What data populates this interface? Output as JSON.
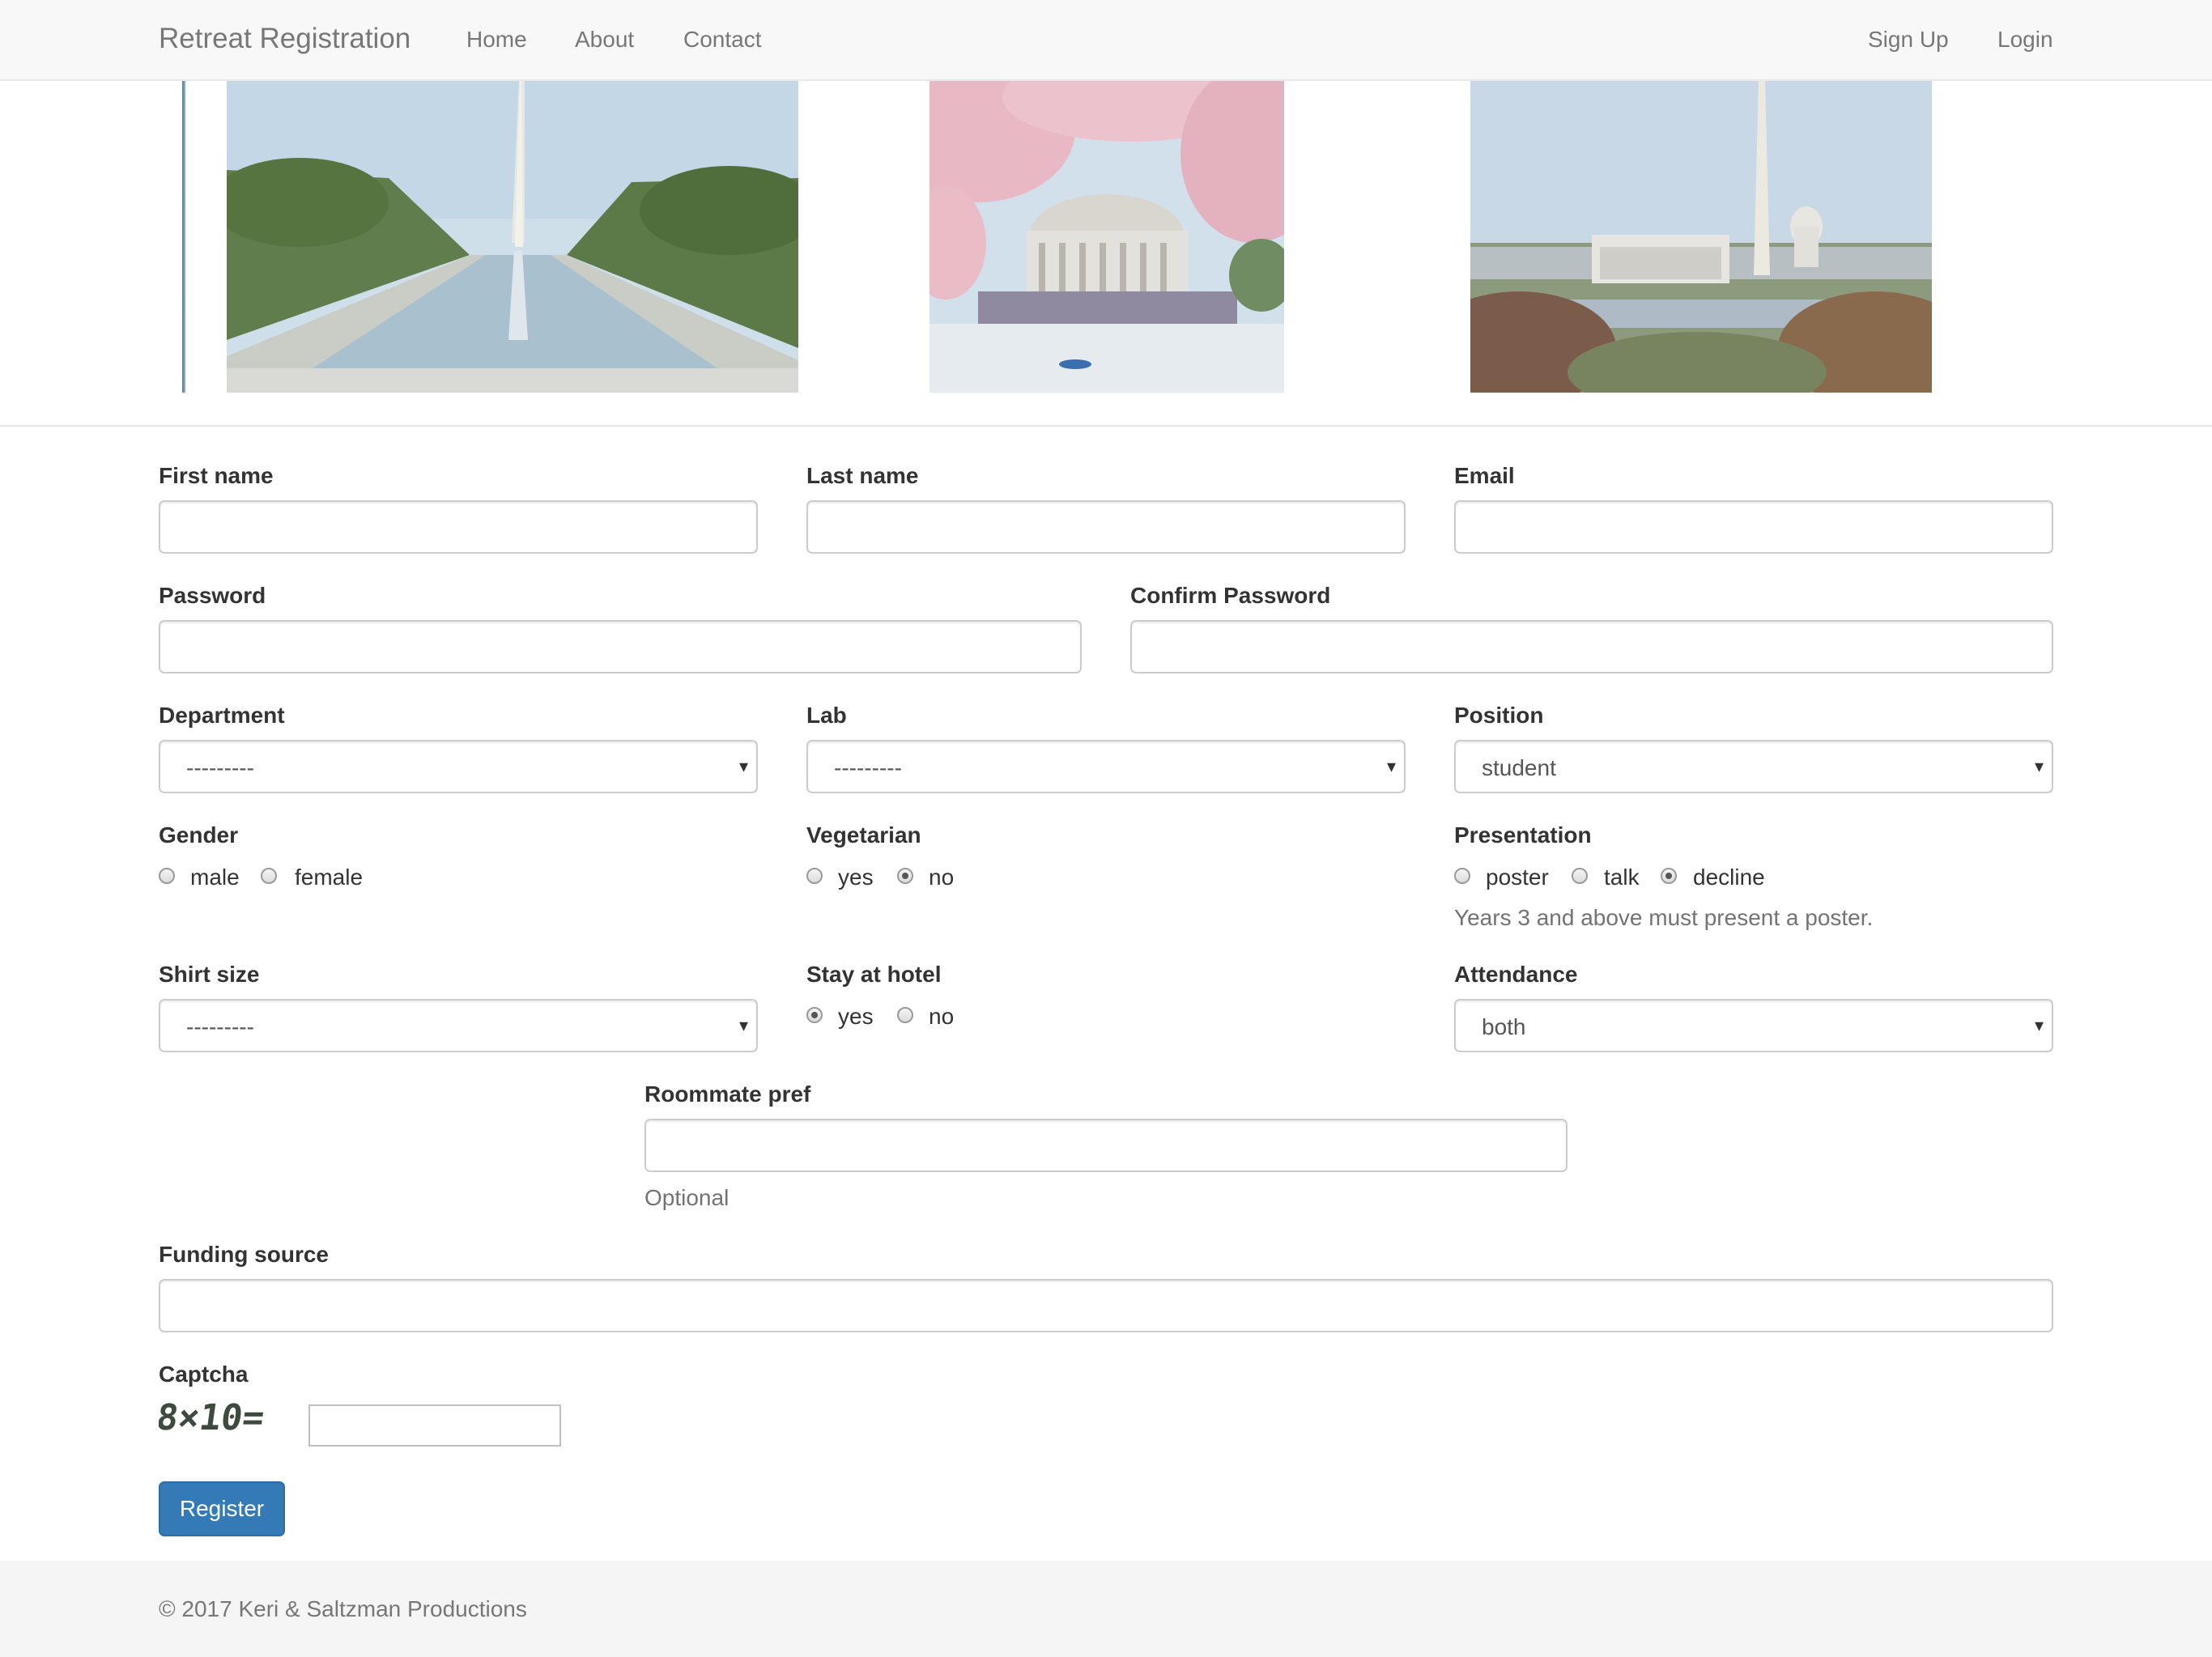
{
  "navbar": {
    "brand": "Retreat Registration",
    "links": [
      "Home",
      "About",
      "Contact"
    ],
    "right_links": [
      "Sign Up",
      "Login"
    ]
  },
  "gallery": {
    "photos": [
      "reflecting-pool",
      "jefferson-memorial-cherry-blossoms",
      "lincoln-memorial-skyline"
    ]
  },
  "form": {
    "first_name": {
      "label": "First name",
      "value": ""
    },
    "last_name": {
      "label": "Last name",
      "value": ""
    },
    "email": {
      "label": "Email",
      "value": ""
    },
    "password": {
      "label": "Password",
      "value": ""
    },
    "confirm_password": {
      "label": "Confirm Password",
      "value": ""
    },
    "department": {
      "label": "Department",
      "selected": "---------"
    },
    "lab": {
      "label": "Lab",
      "selected": "---------"
    },
    "position": {
      "label": "Position",
      "selected": "student"
    },
    "gender": {
      "label": "Gender",
      "options": [
        "male",
        "female"
      ],
      "checked": ""
    },
    "vegetarian": {
      "label": "Vegetarian",
      "options": [
        "yes",
        "no"
      ],
      "checked": "no"
    },
    "presentation": {
      "label": "Presentation",
      "options": [
        "poster",
        "talk",
        "decline"
      ],
      "checked": "decline",
      "help": "Years 3 and above must present a poster."
    },
    "shirt_size": {
      "label": "Shirt size",
      "selected": "---------"
    },
    "stay_at_hotel": {
      "label": "Stay at hotel",
      "options": [
        "yes",
        "no"
      ],
      "checked": "yes"
    },
    "attendance": {
      "label": "Attendance",
      "selected": "both"
    },
    "roommate_pref": {
      "label": "Roommate pref",
      "value": "",
      "help": "Optional"
    },
    "funding_source": {
      "label": "Funding source",
      "value": ""
    },
    "captcha": {
      "label": "Captcha",
      "image_text": "8×10=",
      "value": ""
    },
    "register_label": "Register"
  },
  "footer": {
    "text": "© 2017 Keri & Saltzman Productions"
  },
  "colors": {
    "primary": "#337ab7",
    "navbar_bg": "#f8f8f8",
    "footer_bg": "#f5f5f5"
  }
}
